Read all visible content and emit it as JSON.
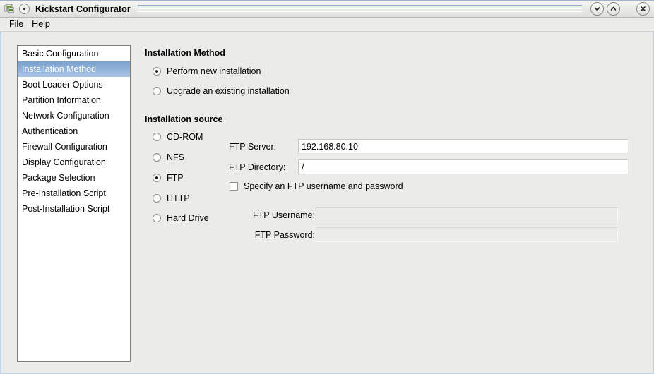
{
  "window": {
    "title": "Kickstart Configurator",
    "app_icon": "packages-icon",
    "window_menu_icon": "window-menu-icon",
    "controls": {
      "minimize": "chevron-down-icon",
      "maximize": "chevron-up-icon",
      "close": "close-x-icon"
    },
    "border_color": "#c3d3e6"
  },
  "menubar": {
    "items": [
      {
        "label": "File",
        "mnemonic": "F"
      },
      {
        "label": "Help",
        "mnemonic": "H"
      }
    ]
  },
  "sidebar": {
    "selected_index": 1,
    "selected_color": "#8fb0d8",
    "items": [
      {
        "label": "Basic Configuration"
      },
      {
        "label": "Installation Method"
      },
      {
        "label": "Boot Loader Options"
      },
      {
        "label": "Partition Information"
      },
      {
        "label": "Network Configuration"
      },
      {
        "label": "Authentication"
      },
      {
        "label": "Firewall Configuration"
      },
      {
        "label": "Display Configuration"
      },
      {
        "label": "Package Selection"
      },
      {
        "label": "Pre-Installation Script"
      },
      {
        "label": "Post-Installation Script"
      }
    ]
  },
  "main": {
    "install_method": {
      "title": "Installation Method",
      "options": [
        {
          "label": "Perform new installation",
          "selected": true
        },
        {
          "label": "Upgrade an existing installation",
          "selected": false
        }
      ]
    },
    "install_source": {
      "title": "Installation source",
      "options": [
        {
          "label": "CD-ROM",
          "selected": false
        },
        {
          "label": "NFS",
          "selected": false
        },
        {
          "label": "FTP",
          "selected": true
        },
        {
          "label": "HTTP",
          "selected": false
        },
        {
          "label": "Hard Drive",
          "selected": false
        }
      ],
      "fields": {
        "ftp_server_label": "FTP Server:",
        "ftp_server_value": "192.168.80.10",
        "ftp_server_placeholder": "",
        "ftp_directory_label": "FTP Directory:",
        "ftp_directory_value": "/",
        "ftp_directory_placeholder": "",
        "specify_credentials_label": "Specify an FTP username and password",
        "specify_credentials_checked": false,
        "ftp_username_label": "FTP Username:",
        "ftp_username_value": "",
        "ftp_username_placeholder": "",
        "ftp_password_label": "FTP Password:",
        "ftp_password_value": "",
        "ftp_password_placeholder": ""
      }
    }
  }
}
